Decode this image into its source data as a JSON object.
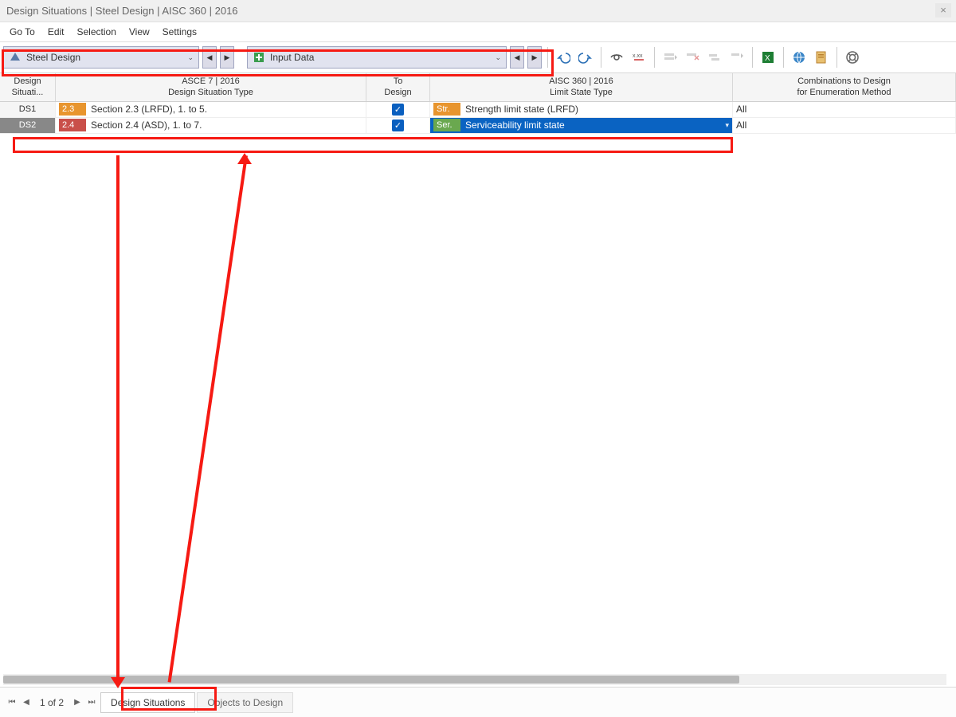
{
  "title": "Design Situations | Steel Design | AISC 360 | 2016",
  "menu": {
    "goTo": "Go To",
    "edit": "Edit",
    "selection": "Selection",
    "view": "View",
    "settings": "Settings"
  },
  "toolbar": {
    "combo1": "Steel Design",
    "combo2": "Input Data"
  },
  "headers": {
    "ds1": "Design",
    "ds2": "Situati...",
    "type1": "ASCE 7 | 2016",
    "type2": "Design Situation Type",
    "todo1": "To",
    "todo2": "Design",
    "lst1": "AISC 360 | 2016",
    "lst2": "Limit State Type",
    "comb1": "Combinations to Design",
    "comb2": "for Enumeration Method"
  },
  "rows": [
    {
      "id": "DS1",
      "badge": "2.3",
      "type": "Section 2.3 (LRFD), 1. to 5.",
      "todo": true,
      "lstBadge": "Str.",
      "lst": "Strength limit state (LRFD)",
      "comb": "All"
    },
    {
      "id": "DS2",
      "badge": "2.4",
      "type": "Section 2.4 (ASD), 1. to 7.",
      "todo": true,
      "lstBadge": "Ser.",
      "lst": "Serviceability limit state",
      "comb": "All"
    }
  ],
  "footer": {
    "page": "1 of 2",
    "tab1": "Design Situations",
    "tab2": "Objects to Design"
  }
}
